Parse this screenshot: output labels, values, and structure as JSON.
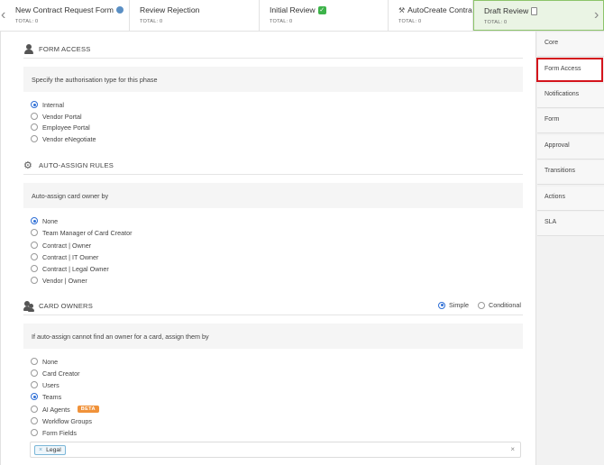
{
  "phases": [
    {
      "title": "New Contract Request Form",
      "total": "TOTAL: 0",
      "icon": "globe-icon"
    },
    {
      "title": "Review Rejection",
      "total": "TOTAL: 0",
      "icon": ""
    },
    {
      "title": "Initial Review",
      "total": "TOTAL: 0",
      "icon": "check-icon"
    },
    {
      "title": "AutoCreate Contract",
      "total": "TOTAL: 0",
      "icon": "tools-icon"
    },
    {
      "title": "Draft Review",
      "total": "TOTAL: 0",
      "icon": "document-icon"
    }
  ],
  "form_access": {
    "title": "FORM ACCESS",
    "description": "Specify the authorisation type for this phase",
    "options": [
      "Internal",
      "Vendor Portal",
      "Employee Portal",
      "Vendor eNegotiate"
    ],
    "selected": "Internal"
  },
  "auto_assign": {
    "title": "AUTO-ASSIGN RULES",
    "description": "Auto-assign card owner by",
    "options": [
      "None",
      "Team Manager of Card Creator",
      "Contract | Owner",
      "Contract | IT Owner",
      "Contract | Legal Owner",
      "Vendor | Owner"
    ],
    "selected": "None"
  },
  "card_owners": {
    "title": "CARD OWNERS",
    "mode_simple": "Simple",
    "mode_conditional": "Conditional",
    "mode_selected": "Simple",
    "description": "If auto-assign cannot find an owner for a card, assign them by",
    "options": [
      "None",
      "Card Creator",
      "Users",
      "Teams",
      "AI Agents",
      "Workflow Groups",
      "Form Fields"
    ],
    "selected": "Teams",
    "beta_label": "BETA",
    "selected_tags": [
      "Legal"
    ],
    "chip_remove": "×",
    "clear_all": "×"
  },
  "sidebar": {
    "items": [
      "Core",
      "Form Access",
      "Notifications",
      "Form",
      "Approval",
      "Transitions",
      "Actions",
      "SLA"
    ],
    "selected": "Form Access"
  },
  "colors": {
    "accent": "#2f6fd6",
    "active_phase": "#eaf4e4",
    "selected_outline": "#d4141c",
    "beta": "#f0923a"
  }
}
